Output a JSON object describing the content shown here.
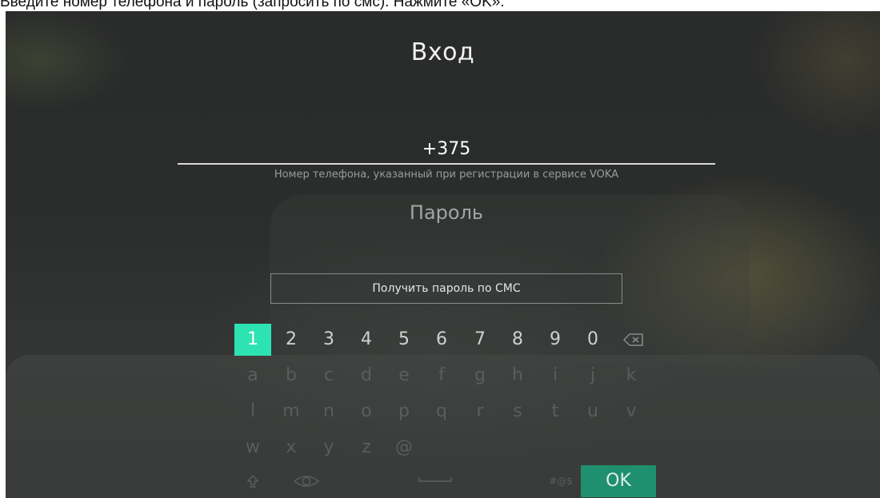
{
  "caption": "Введите номер телефона и пароль (запросить по смс). Нажмите «OK».",
  "screen": {
    "title": "Вход",
    "phone": {
      "value": "+375",
      "hint": "Номер телефона, указанный при регистрации в сервисе VOKA"
    },
    "password": {
      "placeholder": "Пароль"
    },
    "sms_button": "Получить пароль по СМС"
  },
  "keyboard": {
    "digits": [
      "1",
      "2",
      "3",
      "4",
      "5",
      "6",
      "7",
      "8",
      "9",
      "0"
    ],
    "backspace_icon": "backspace-icon",
    "row2": [
      "a",
      "b",
      "c",
      "d",
      "e",
      "f",
      "g",
      "h",
      "i",
      "j",
      "k"
    ],
    "row3": [
      "l",
      "m",
      "n",
      "o",
      "p",
      "q",
      "r",
      "s",
      "t",
      "u",
      "v"
    ],
    "row4": [
      "w",
      "x",
      "y",
      "z",
      "@"
    ],
    "shift_icon": "shift-icon",
    "eye_icon": "eye-icon",
    "space_icon": "space-icon",
    "symbols_label": "#@$",
    "ok_label": "OK",
    "focused_key": "1",
    "colors": {
      "focus": "#2ee3b2",
      "ok": "#1f8f6f"
    }
  }
}
